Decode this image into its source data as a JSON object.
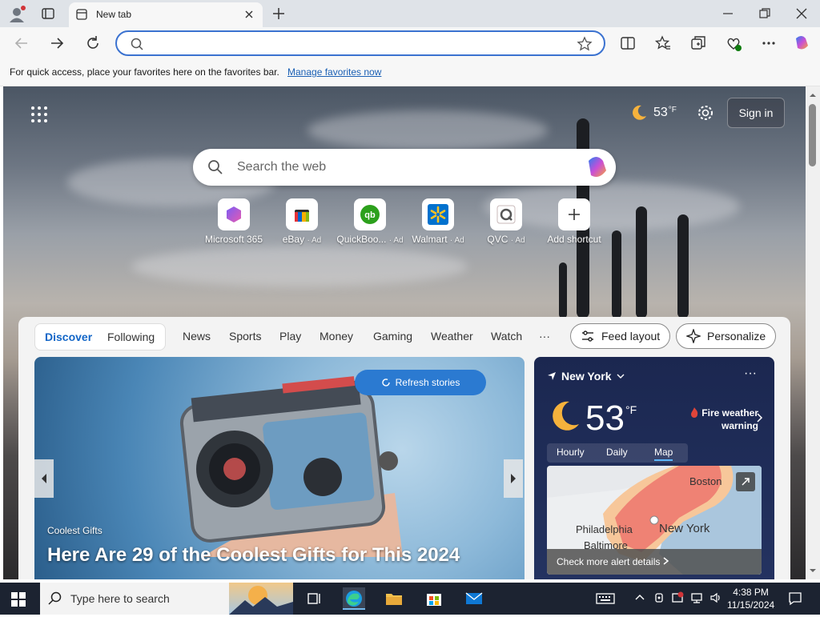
{
  "browser": {
    "tab_title": "New tab",
    "favorites_bar": {
      "message": "For quick access, place your favorites here on the favorites bar.",
      "link": "Manage favorites now"
    }
  },
  "newtab": {
    "weather_temp": "53",
    "weather_unit": "°F",
    "sign_in": "Sign in",
    "search_placeholder": "Search the web",
    "shortcuts": [
      {
        "label": "Microsoft 365",
        "ad": ""
      },
      {
        "label": "eBay",
        "ad": "· Ad"
      },
      {
        "label": "QuickBoo...",
        "ad": "· Ad"
      },
      {
        "label": "Walmart",
        "ad": "· Ad"
      },
      {
        "label": "QVC",
        "ad": "· Ad"
      },
      {
        "label": "Add shortcut",
        "ad": ""
      }
    ]
  },
  "feed": {
    "tabs": {
      "discover": "Discover",
      "following": "Following"
    },
    "categories": [
      "News",
      "Sports",
      "Play",
      "Money",
      "Gaming",
      "Weather",
      "Watch"
    ],
    "more": "···",
    "feed_layout": "Feed layout",
    "personalize": "Personalize",
    "hero": {
      "refresh": "Refresh stories",
      "category": "Coolest Gifts",
      "title": "Here Are 29 of the Coolest Gifts for This 2024"
    },
    "weather": {
      "location": "New York",
      "temp": "53",
      "unit": "°F",
      "warning": "Fire weather warning",
      "tabs": [
        "Hourly",
        "Daily",
        "Map"
      ],
      "map_labels": [
        "Boston",
        "Philadelphia",
        "New York",
        "Baltimore"
      ],
      "alert_link": "Check more alert details"
    }
  },
  "taskbar": {
    "search_placeholder": "Type here to search",
    "time": "4:38 PM",
    "date": "11/15/2024"
  },
  "colors": {
    "accent": "#1366c7",
    "address_border": "#3b72d0",
    "taskbar": "#1c2331",
    "weather_card": "#1b2750"
  }
}
